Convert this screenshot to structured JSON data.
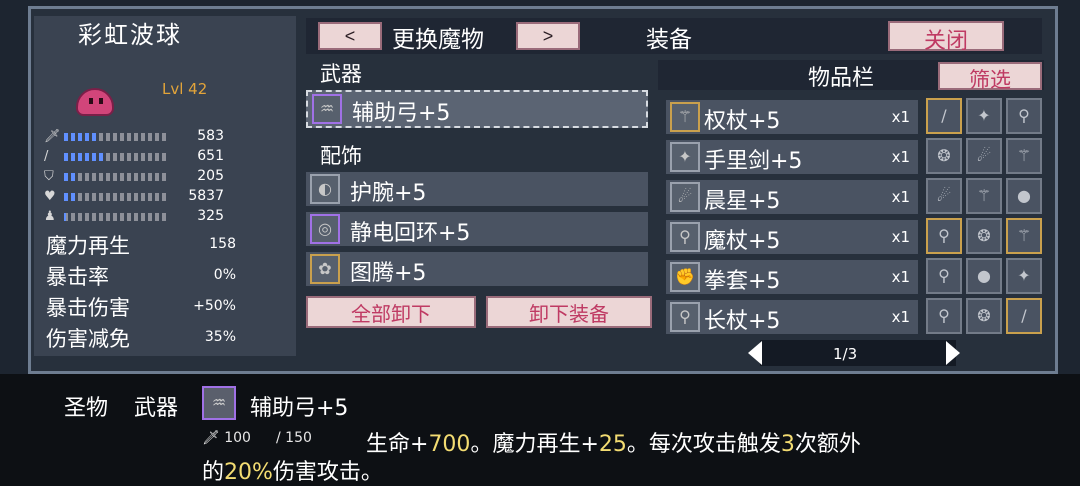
{
  "hero": {
    "name": "彩虹波球",
    "level": "Lvl 42",
    "stats": [
      {
        "icon": "sword-icon",
        "glyph": "🗡",
        "value": "583",
        "fill": 0.32
      },
      {
        "icon": "wand-icon",
        "glyph": "/",
        "value": "651",
        "fill": 0.38
      },
      {
        "icon": "shield-icon",
        "glyph": "⛉",
        "value": "205",
        "fill": 0.12
      },
      {
        "icon": "heart-icon",
        "glyph": "♥",
        "value": "5837",
        "fill": 0.14
      },
      {
        "icon": "speed-icon",
        "glyph": "♟",
        "value": "325",
        "fill": 0.02
      }
    ],
    "extra": [
      {
        "label": "魔力再生",
        "value": "158"
      },
      {
        "label": "暴击率",
        "value": "0%"
      },
      {
        "label": "暴击伤害",
        "value": "+50%"
      },
      {
        "label": "伤害减免",
        "value": "35%"
      }
    ]
  },
  "top": {
    "prev": "<",
    "change_monster": "更换魔物",
    "next": ">",
    "title": "装备",
    "close": "关闭"
  },
  "weapon": {
    "section": "武器",
    "item": "辅助弓+5"
  },
  "accessory": {
    "section": "配饰",
    "items": [
      "护腕+5",
      "静电回环+5",
      "图腾+5"
    ]
  },
  "actions": {
    "unequip_all": "全部卸下",
    "unequip": "卸下装备"
  },
  "inventory": {
    "title": "物品栏",
    "filter": "筛选",
    "items": [
      {
        "label": "权杖+5",
        "qty": "x1"
      },
      {
        "label": "手里剑+5",
        "qty": "x1"
      },
      {
        "label": "晨星+5",
        "qty": "x1"
      },
      {
        "label": "魔杖+5",
        "qty": "x1"
      },
      {
        "label": "拳套+5",
        "qty": "x1"
      },
      {
        "label": "长杖+5",
        "qty": "x1"
      }
    ],
    "page": "1/3"
  },
  "tooltip": {
    "rarity": "圣物",
    "type": "武器",
    "name": "辅助弓+5",
    "atk": "100",
    "mag": "150",
    "desc": [
      {
        "t": "生命+",
        "c": "w"
      },
      {
        "t": "700",
        "c": "y"
      },
      {
        "t": "。魔力再生+",
        "c": "w"
      },
      {
        "t": "25",
        "c": "y"
      },
      {
        "t": "。每次攻击触发",
        "c": "w"
      },
      {
        "t": "3",
        "c": "y"
      },
      {
        "t": "次额外",
        "c": "w"
      }
    ],
    "desc2": [
      {
        "t": "的",
        "c": "w"
      },
      {
        "t": "20%",
        "c": "y"
      },
      {
        "t": "伤害攻击。",
        "c": "w"
      }
    ]
  }
}
